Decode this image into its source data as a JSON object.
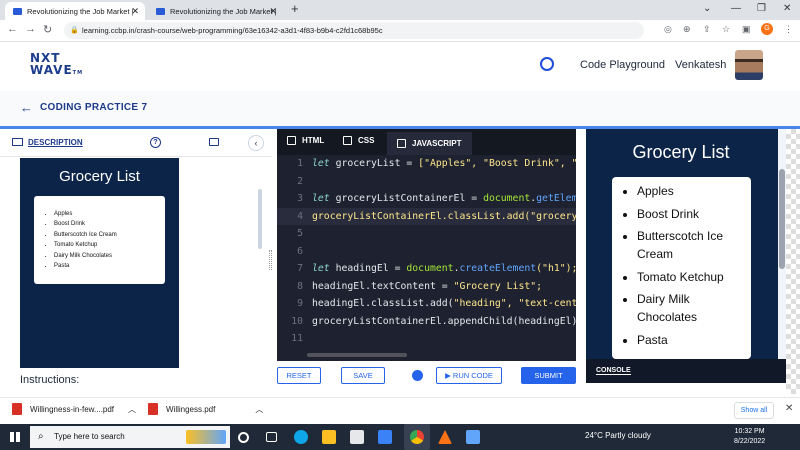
{
  "browser": {
    "tabs": [
      {
        "title": "Revolutionizing the Job Market |"
      },
      {
        "title": "Revolutionizing the Job Market |"
      }
    ],
    "url": "learning.ccbp.in/crash-course/web-programming/63e16342-a3d1-4f83-b9b4-c2fd1c68b95c",
    "profile_letter": "G"
  },
  "header": {
    "logo": {
      "line1": "NXT",
      "line2": "WAVE",
      "tm": "TM"
    },
    "code_playground": "Code Playground",
    "user_name": "Venkatesh"
  },
  "page": {
    "title": "CODING PRACTICE 7"
  },
  "left_panel": {
    "tab_description": "DESCRIPTION",
    "instructions_heading": "Instructions:",
    "preview_title": "Grocery List",
    "preview_items": [
      "Apples",
      "Boost Drink",
      "Butterscotch Ice Cream",
      "Tomato Ketchup",
      "Dairy Milk Chocolates",
      "Pasta"
    ]
  },
  "editor": {
    "tabs": [
      "HTML",
      "CSS",
      "JAVASCRIPT"
    ],
    "active_tab": "JAVASCRIPT",
    "lines": [
      {
        "n": "1",
        "segs": [
          {
            "t": "let ",
            "c": "#8bd5ca",
            "i": true
          },
          {
            "t": "groceryList ",
            "c": "#e5e7eb"
          },
          {
            "t": "= ",
            "c": "#e5e7eb"
          },
          {
            "t": "[\"Apples\", \"Boost Drink\", \"",
            "c": "#fde68a"
          }
        ]
      },
      {
        "n": "2",
        "segs": []
      },
      {
        "n": "3",
        "segs": [
          {
            "t": "let ",
            "c": "#8bd5ca",
            "i": true
          },
          {
            "t": "groceryListContainerEl ",
            "c": "#e5e7eb"
          },
          {
            "t": "= ",
            "c": "#e5e7eb"
          },
          {
            "t": "document",
            "c": "#a3e635"
          },
          {
            "t": ".",
            "c": "#e5e7eb"
          },
          {
            "t": "getElem",
            "c": "#60a5fa"
          }
        ]
      },
      {
        "n": "4",
        "segs": [
          {
            "t": "groceryListContainerEl.classList.add(\"grocery",
            "c": "#fde68a"
          }
        ],
        "hl": true
      },
      {
        "n": "5",
        "segs": []
      },
      {
        "n": "6",
        "segs": []
      },
      {
        "n": "7",
        "segs": [
          {
            "t": "let ",
            "c": "#8bd5ca",
            "i": true
          },
          {
            "t": "headingEl ",
            "c": "#e5e7eb"
          },
          {
            "t": "= ",
            "c": "#e5e7eb"
          },
          {
            "t": "document",
            "c": "#a3e635"
          },
          {
            "t": ".",
            "c": "#e5e7eb"
          },
          {
            "t": "createElement",
            "c": "#60a5fa"
          },
          {
            "t": "(\"h1\");",
            "c": "#fde68a"
          }
        ]
      },
      {
        "n": "8",
        "segs": [
          {
            "t": "headingEl.textContent ",
            "c": "#e5e7eb"
          },
          {
            "t": "= ",
            "c": "#e5e7eb"
          },
          {
            "t": "\"Grocery List\";",
            "c": "#fde68a"
          }
        ]
      },
      {
        "n": "9",
        "segs": [
          {
            "t": "headingEl.classList.add(",
            "c": "#e5e7eb"
          },
          {
            "t": "\"heading\", \"text-cent",
            "c": "#fde68a"
          }
        ]
      },
      {
        "n": "10",
        "segs": [
          {
            "t": "groceryListContainerEl.appendChild(headingEl)",
            "c": "#e5e7eb"
          }
        ]
      },
      {
        "n": "11",
        "segs": []
      }
    ],
    "buttons": {
      "reset": "RESET",
      "save": "SAVE",
      "run": "▶ RUN CODE",
      "submit": "SUBMIT"
    }
  },
  "preview": {
    "title": "Grocery List",
    "items": [
      "Apples",
      "Boost Drink",
      "Butterscotch Ice Cream",
      "Tomato Ketchup",
      "Dairy Milk Chocolates",
      "Pasta"
    ],
    "console_label": "CONSOLE"
  },
  "downloads": {
    "items": [
      {
        "name": "Willingness-in-few....pdf"
      },
      {
        "name": "Willingess.pdf"
      }
    ],
    "show_all": "Show all"
  },
  "taskbar": {
    "search_placeholder": "Type here to search",
    "weather": "24°C  Partly cloudy",
    "time": "10:32 PM",
    "date": "8/22/2022"
  },
  "colors": {
    "primary": "#2563eb",
    "navy": "#0c2448",
    "editor_bg": "#1e2130"
  }
}
